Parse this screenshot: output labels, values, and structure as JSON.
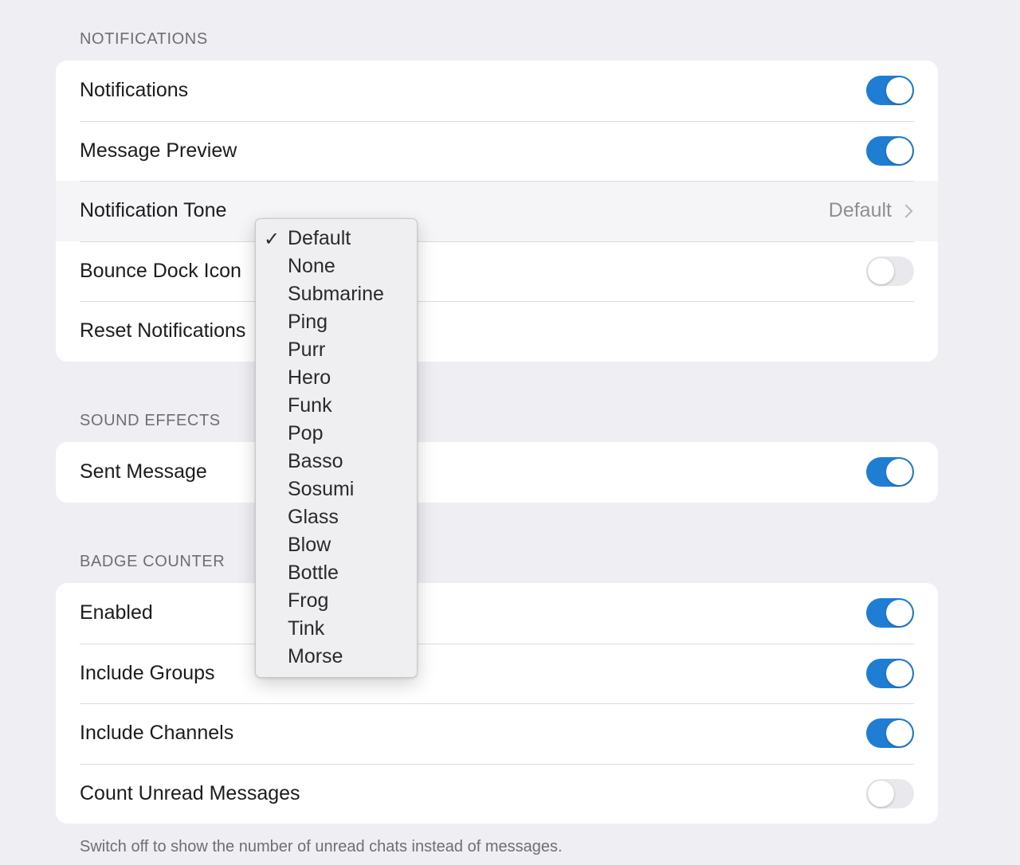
{
  "sections": {
    "notifications": {
      "header": "NOTIFICATIONS",
      "rows": [
        {
          "label": "Notifications",
          "toggle": true
        },
        {
          "label": "Message Preview",
          "toggle": true
        },
        {
          "label": "Notification Tone",
          "value": "Default"
        },
        {
          "label": "Bounce Dock Icon",
          "toggle": false
        },
        {
          "label": "Reset Notifications"
        }
      ]
    },
    "sound_effects": {
      "header": "SOUND EFFECTS",
      "rows": [
        {
          "label": "Sent Message",
          "toggle": true
        }
      ]
    },
    "badge_counter": {
      "header": "BADGE COUNTER",
      "rows": [
        {
          "label": "Enabled",
          "toggle": true
        },
        {
          "label": "Include Groups",
          "toggle": true
        },
        {
          "label": "Include Channels",
          "toggle": true
        },
        {
          "label": "Count Unread Messages",
          "toggle": false
        }
      ],
      "footer": "Switch off to show the number of unread chats instead of messages."
    }
  },
  "tone_menu": {
    "checkmark": "✓",
    "selected": "Default",
    "options": [
      "Default",
      "None",
      "Submarine",
      "Ping",
      "Purr",
      "Hero",
      "Funk",
      "Pop",
      "Basso",
      "Sosumi",
      "Glass",
      "Blow",
      "Bottle",
      "Frog",
      "Tink",
      "Morse"
    ]
  },
  "colors": {
    "toggle_on": "#1f7ed4",
    "toggle_off": "#e9e9ed",
    "background": "#eeeef3"
  }
}
